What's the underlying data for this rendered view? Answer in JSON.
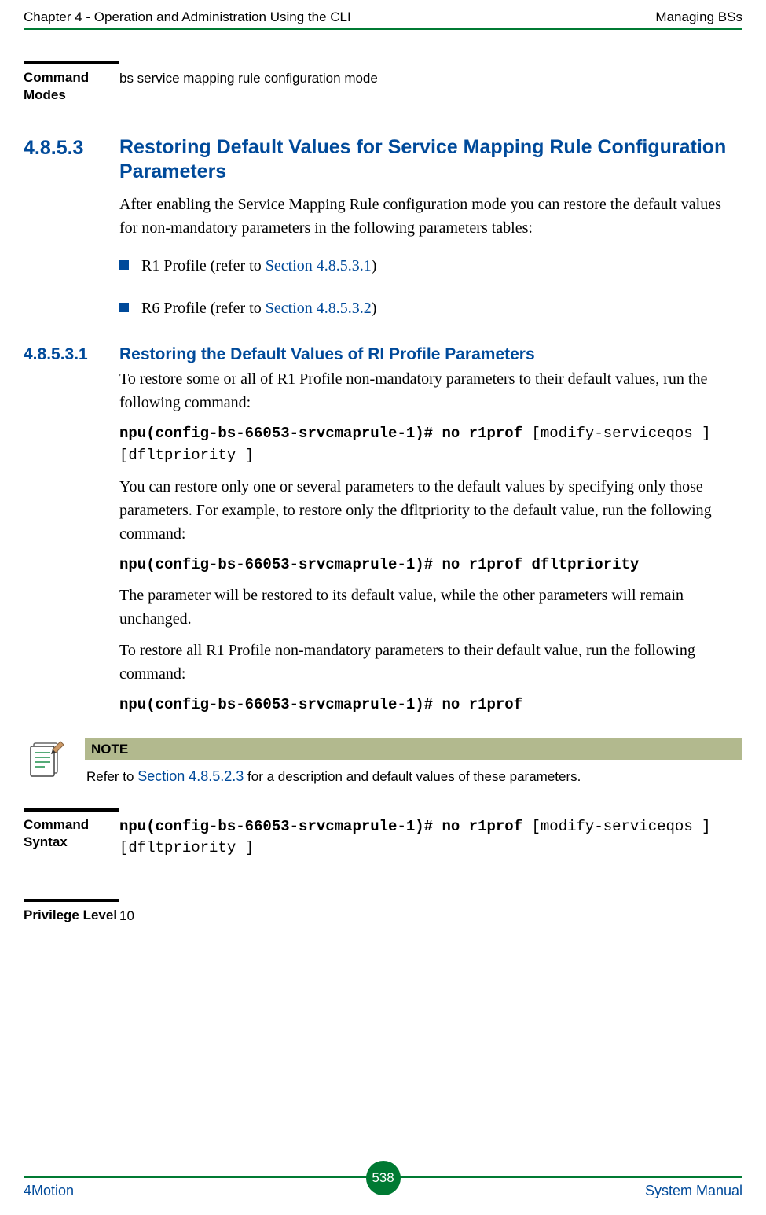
{
  "header": {
    "left": "Chapter 4 - Operation and Administration Using the CLI",
    "right": "Managing BSs"
  },
  "command_modes": {
    "label": "Command Modes",
    "value": "bs service mapping rule configuration mode"
  },
  "section4853": {
    "number": "4.8.5.3",
    "title": "Restoring Default Values for Service Mapping Rule Configuration Parameters",
    "intro": "After enabling the Service Mapping Rule configuration mode you can restore the default values for non-mandatory parameters in the following parameters tables:",
    "bullets": [
      {
        "prefix": "R1 Profile (refer to ",
        "link": "Section 4.8.5.3.1",
        "suffix": ")"
      },
      {
        "prefix": "R6 Profile (refer to ",
        "link": "Section 4.8.5.3.2",
        "suffix": ")"
      }
    ]
  },
  "section48531": {
    "number": "4.8.5.3.1",
    "title": "Restoring the Default Values of RI Profile Parameters",
    "p1": "To restore some or all of R1 Profile non-mandatory parameters to their default values, run the following command:",
    "cmd1_bold": "npu(config-bs-66053-srvcmaprule-1)# no r1prof ",
    "cmd1_rest": "[modify-serviceqos ] [dfltpriority ]",
    "p2": "You can restore only one or several parameters to the default values by specifying only those parameters. For example, to restore only the dfltpriority to the default value, run the following command:",
    "cmd2": "npu(config-bs-66053-srvcmaprule-1)# no r1prof dfltpriority",
    "p3": "The parameter will be restored to its default value, while the other parameters will remain unchanged.",
    "p4": "To restore all R1 Profile non-mandatory parameters to their default value, run the following command:",
    "cmd3": "npu(config-bs-66053-srvcmaprule-1)# no r1prof"
  },
  "note": {
    "head": "NOTE",
    "text_prefix": "Refer to ",
    "text_link": "Section 4.8.5.2.3",
    "text_suffix": " for a description and default values of these parameters."
  },
  "command_syntax": {
    "label": "Command Syntax",
    "bold": "npu(config-bs-66053-srvcmaprule-1)# no r1prof ",
    "rest": "[modify-serviceqos ] [dfltpriority ]"
  },
  "privilege": {
    "label": "Privilege Level",
    "value": "10"
  },
  "footer": {
    "left": "4Motion",
    "page": "538",
    "right": "System Manual"
  }
}
